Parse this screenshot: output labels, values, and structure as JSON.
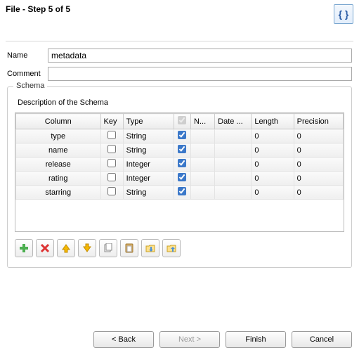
{
  "header": {
    "title": "File - Step 5 of 5",
    "icon_label": "{ }"
  },
  "form": {
    "name_label": "Name",
    "name_value": "metadata",
    "comment_label": "Comment",
    "comment_value": ""
  },
  "fieldset": {
    "legend": "Schema",
    "description": "Description of the Schema"
  },
  "columns": {
    "column": "Column",
    "key": "Key",
    "type": "Type",
    "null_marker": "✓",
    "n": "N...",
    "date": "Date ...",
    "length": "Length",
    "precision": "Precision"
  },
  "rows": [
    {
      "column": "type",
      "key": false,
      "type": "String",
      "nullable": true,
      "date": "",
      "length": "0",
      "precision": "0"
    },
    {
      "column": "name",
      "key": false,
      "type": "String",
      "nullable": true,
      "date": "",
      "length": "0",
      "precision": "0"
    },
    {
      "column": "release",
      "key": false,
      "type": "Integer",
      "nullable": true,
      "date": "",
      "length": "0",
      "precision": "0"
    },
    {
      "column": "rating",
      "key": false,
      "type": "Integer",
      "nullable": true,
      "date": "",
      "length": "0",
      "precision": "0"
    },
    {
      "column": "starring",
      "key": false,
      "type": "String",
      "nullable": true,
      "date": "",
      "length": "0",
      "precision": "0"
    }
  ],
  "buttons": {
    "back": "< Back",
    "next": "Next >",
    "finish": "Finish",
    "cancel": "Cancel"
  }
}
